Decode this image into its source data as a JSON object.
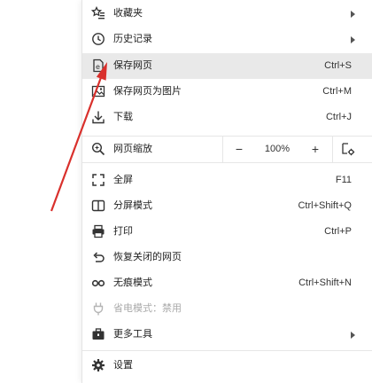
{
  "menu": {
    "items": [
      {
        "label": "收藏夹",
        "shortcut": "",
        "has_submenu": true,
        "icon": "star-list-icon"
      },
      {
        "label": "历史记录",
        "shortcut": "",
        "has_submenu": true,
        "icon": "clock-icon"
      },
      {
        "label": "保存网页",
        "shortcut": "Ctrl+S",
        "has_submenu": false,
        "icon": "save-page-icon"
      },
      {
        "label": "保存网页为图片",
        "shortcut": "Ctrl+M",
        "has_submenu": false,
        "icon": "image-save-icon"
      },
      {
        "label": "下载",
        "shortcut": "Ctrl+J",
        "has_submenu": false,
        "icon": "download-icon"
      },
      {
        "label": "全屏",
        "shortcut": "F11",
        "has_submenu": false,
        "icon": "fullscreen-icon"
      },
      {
        "label": "分屏模式",
        "shortcut": "Ctrl+Shift+Q",
        "has_submenu": false,
        "icon": "split-screen-icon"
      },
      {
        "label": "打印",
        "shortcut": "Ctrl+P",
        "has_submenu": false,
        "icon": "printer-icon"
      },
      {
        "label": "恢复关闭的网页",
        "shortcut": "",
        "has_submenu": false,
        "icon": "undo-icon"
      },
      {
        "label": "无痕模式",
        "shortcut": "Ctrl+Shift+N",
        "has_submenu": false,
        "icon": "incognito-icon"
      },
      {
        "label": "省电模式：禁用",
        "shortcut": "",
        "has_submenu": false,
        "icon": "power-plug-icon"
      },
      {
        "label": "更多工具",
        "shortcut": "",
        "has_submenu": true,
        "icon": "toolbox-icon"
      },
      {
        "label": "设置",
        "shortcut": "",
        "has_submenu": false,
        "icon": "gear-icon"
      }
    ],
    "zoom": {
      "label": "网页缩放",
      "minus": "−",
      "value": "100%",
      "plus": "+"
    },
    "highlighted": "保存网页"
  },
  "colors": {
    "annotation_arrow": "#d9302c",
    "highlight": "#e9e9e9"
  }
}
